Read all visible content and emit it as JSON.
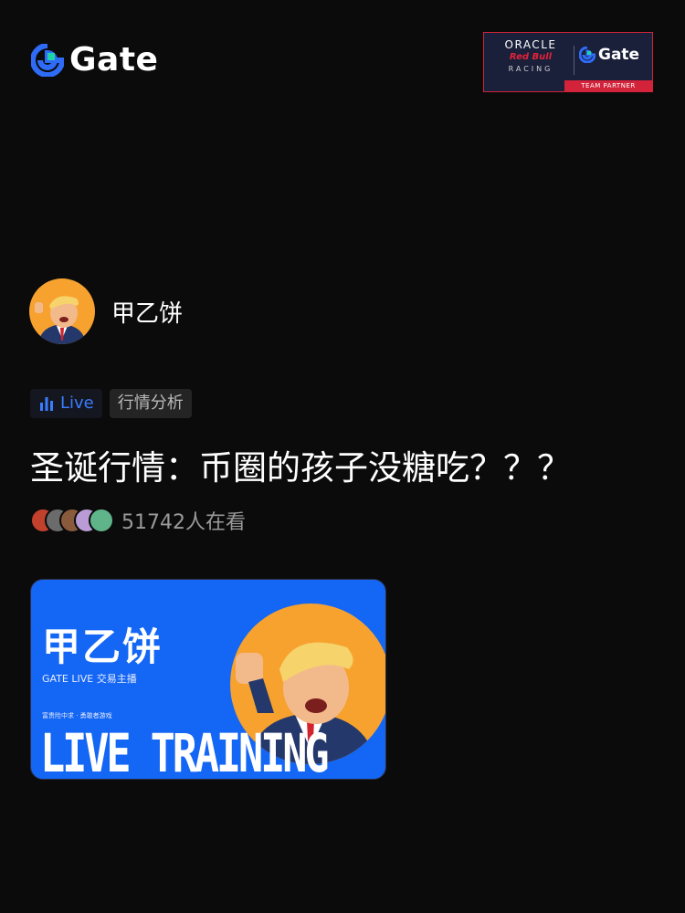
{
  "brand": {
    "name": "Gate"
  },
  "partner": {
    "oracle": "ORACLE",
    "redbull": "Red Bull",
    "racing": "RACING",
    "gate": "Gate",
    "strip": "TEAM PARTNER"
  },
  "host": {
    "name": "甲乙饼",
    "avatar_icon": "host-avatar"
  },
  "tags": [
    {
      "label": "Live",
      "icon": "bar-chart-icon",
      "color": "#3a7cff"
    },
    {
      "label": "行情分析"
    }
  ],
  "title": "圣诞行情：币圈的孩子没糖吃？？？",
  "viewers": {
    "count_text": "51742人在看"
  },
  "cover": {
    "host_name": "甲乙饼",
    "subtitle": "GATE LIVE 交易主播",
    "tagline": "富贵险中求 · 勇敢者游戏",
    "big_text": "LIVE TRAINING"
  },
  "colors": {
    "background": "#0b0b0b",
    "accent": "#3a7cff",
    "cover_blue": "#1466f5",
    "avatar_orange": "#f7a22f"
  }
}
